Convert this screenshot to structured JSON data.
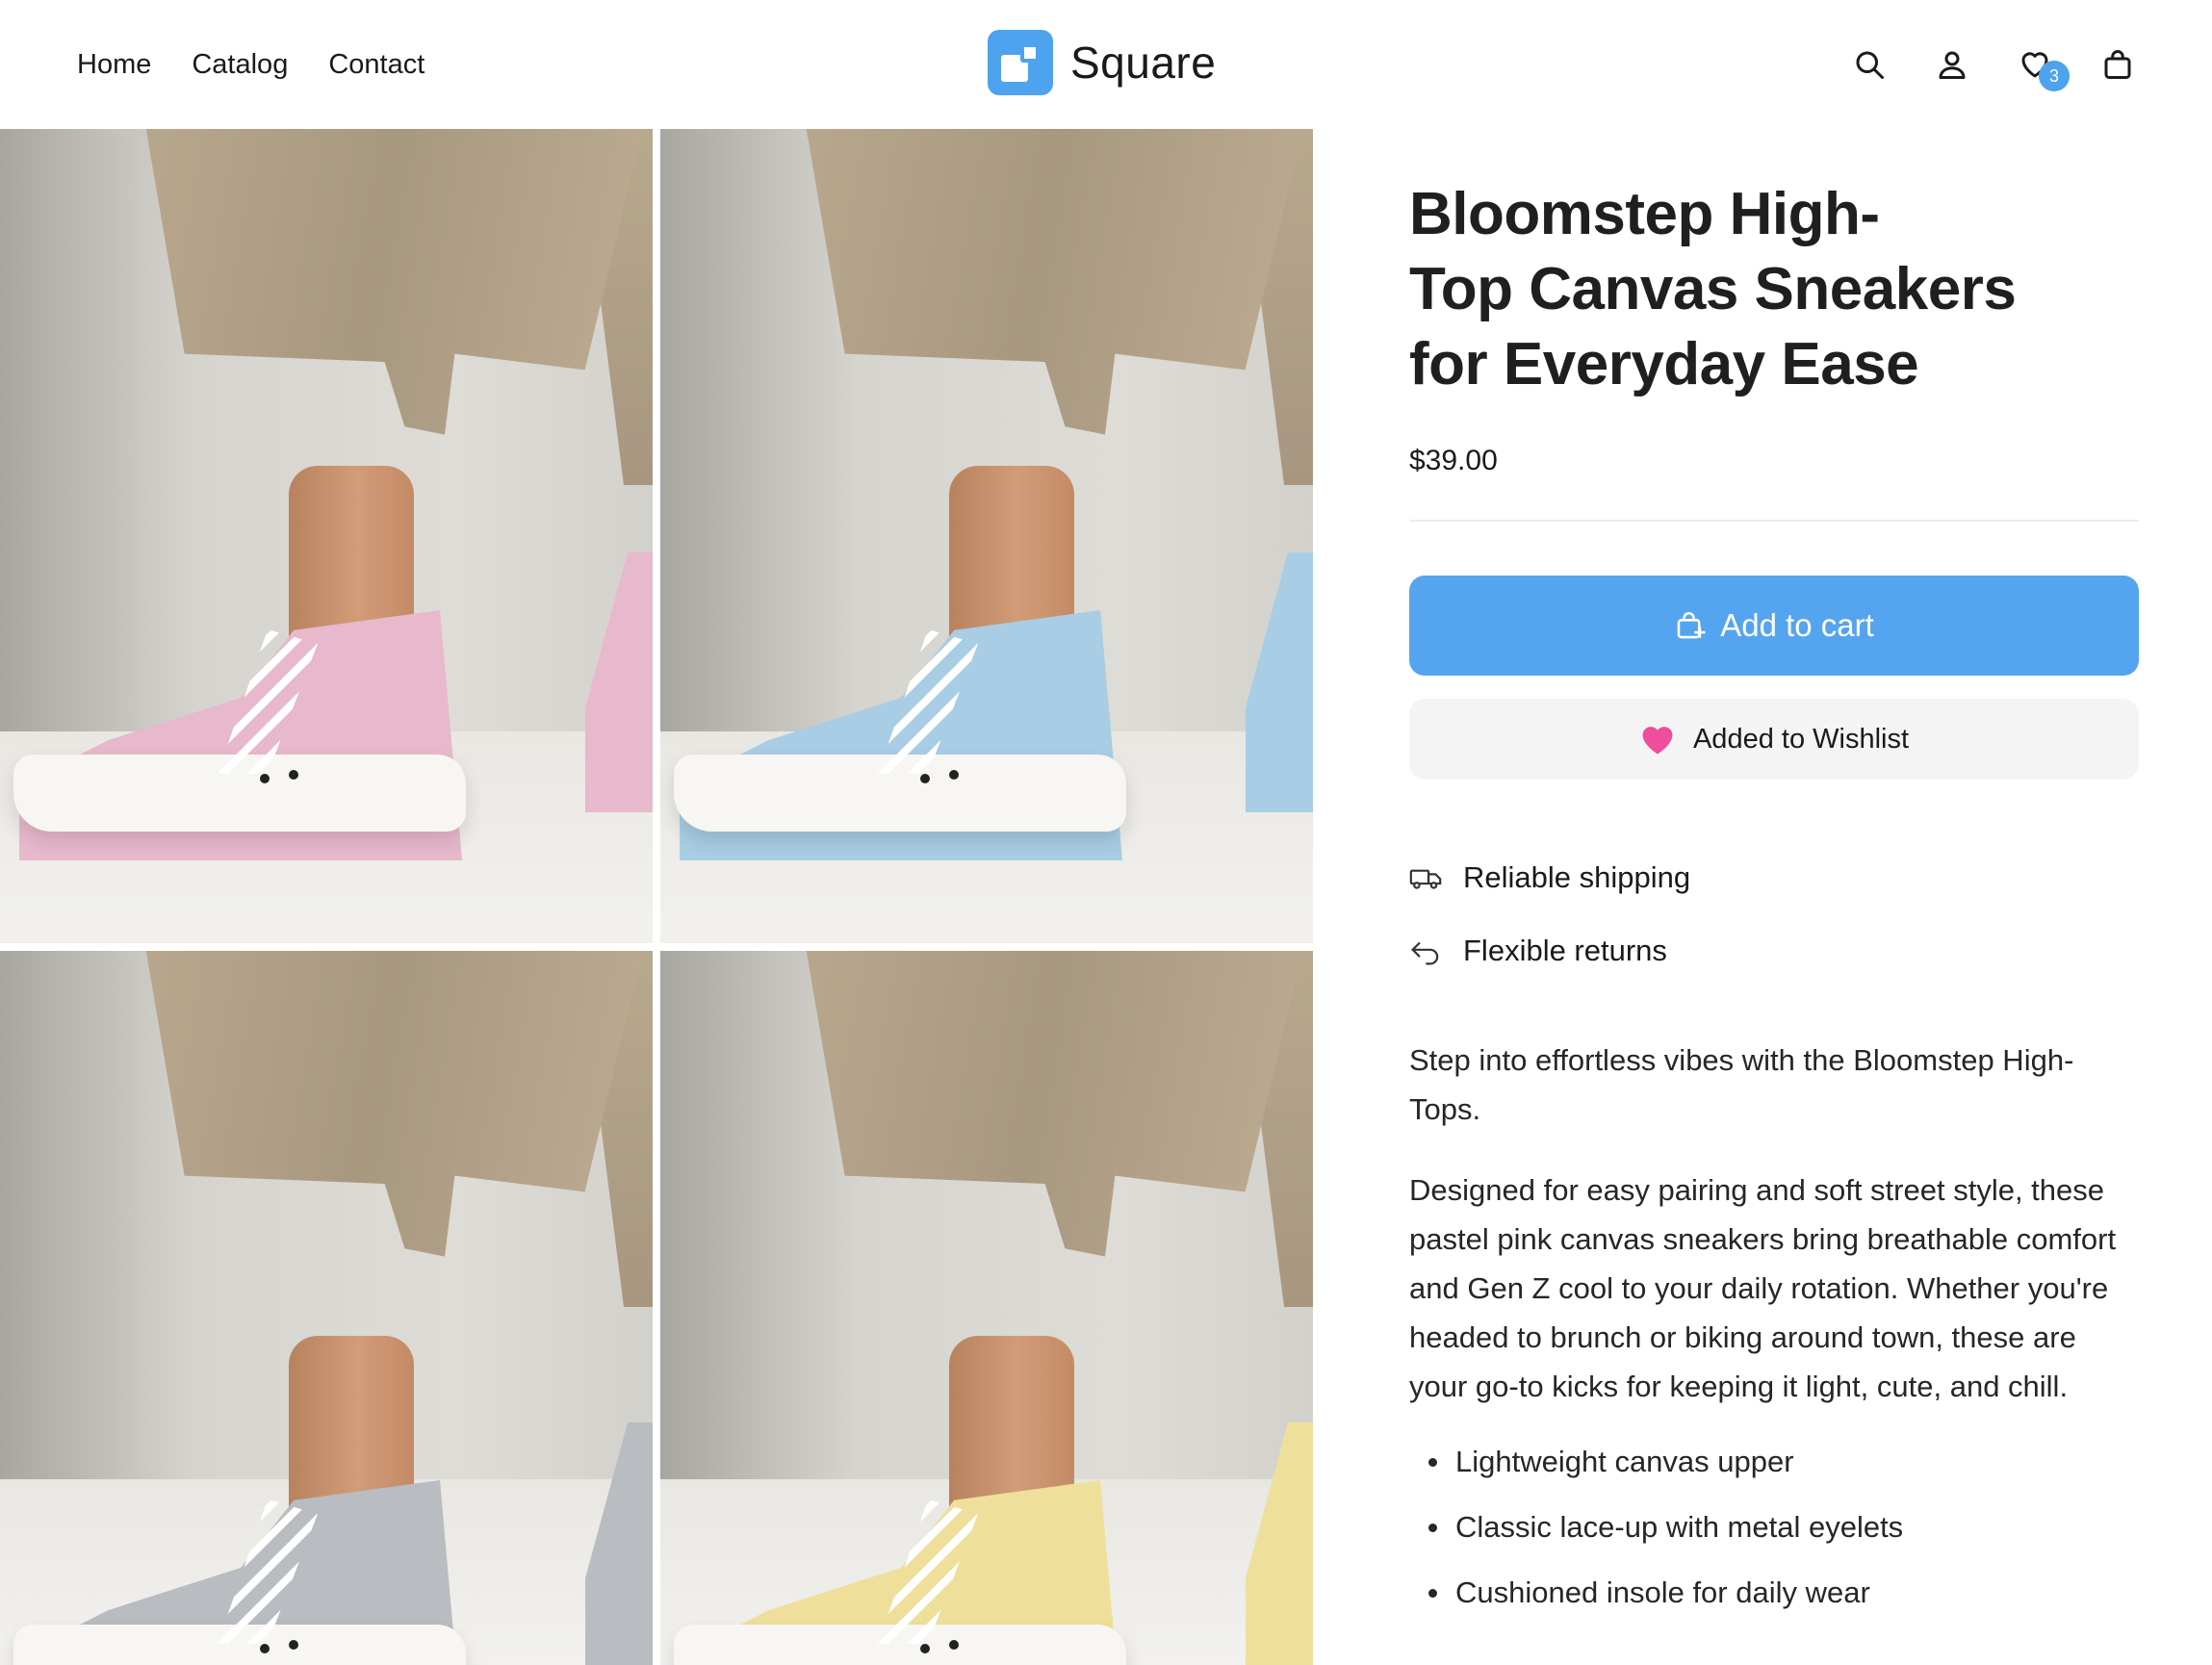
{
  "header": {
    "nav": [
      "Home",
      "Catalog",
      "Contact"
    ],
    "brand": "Square",
    "icons": [
      "search-icon",
      "account-icon",
      "wishlist-icon",
      "cart-icon"
    ],
    "wishlist_count": "3"
  },
  "gallery": {
    "images": [
      {
        "label": "pink sneaker",
        "color": "#e8b8cc"
      },
      {
        "label": "blue sneaker",
        "color": "#a8cde4"
      },
      {
        "label": "gray sneaker",
        "color": "#b9bcc0"
      },
      {
        "label": "yellow sneaker",
        "color": "#eee09a"
      }
    ]
  },
  "product": {
    "title": "Bloomstep High-Top Canvas Sneakers for Everyday Ease",
    "title_lines": [
      "Bloomstep High-",
      "Top Canvas Sneakers",
      "for Everyday Ease"
    ],
    "price": "$39.00",
    "add_to_cart": "Add to cart",
    "wishlist_button": "Added to Wishlist",
    "features": [
      "Reliable shipping",
      "Flexible returns"
    ],
    "description": [
      "Step into effortless vibes with the Bloomstep High-Tops.",
      "Designed for easy pairing and soft street style, these pastel pink canvas sneakers bring breathable comfort and Gen Z cool to your daily rotation. Whether you're headed to brunch or biking around town, these are your go-to kicks for keeping it light, cute, and chill."
    ],
    "bullets": [
      "Lightweight canvas upper",
      "Classic lace-up with metal eyelets",
      "Cushioned insole for daily wear"
    ]
  },
  "colors": {
    "accent": "#55a4f0",
    "heart": "#ee4e9c",
    "wishlist_bg": "#f4f4f4"
  }
}
